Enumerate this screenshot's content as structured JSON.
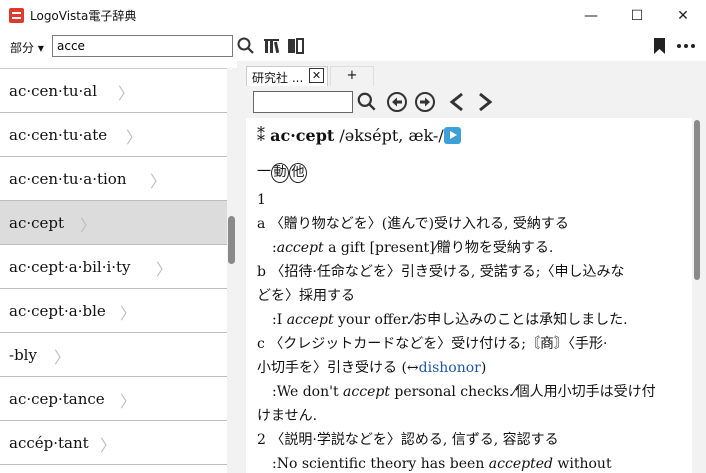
{
  "window": {
    "title": "LogoVista電子辞典",
    "minimize": "—",
    "maximize": "☐",
    "close": "✕"
  },
  "toolbar": {
    "category_label": "部分 ▾",
    "search_value": "acce"
  },
  "word_list": [
    {
      "word": "ac·cen·tu·al",
      "selected": false
    },
    {
      "word": "ac·cen·tu·ate",
      "selected": false
    },
    {
      "word": "ac·cen·tu·a·tion",
      "selected": false
    },
    {
      "word": "ac·cept",
      "selected": true
    },
    {
      "word": "ac·cept·a·bil·i·ty",
      "selected": false
    },
    {
      "word": "ac·cept·a·ble",
      "selected": false
    },
    {
      "word": "-bly",
      "selected": false
    },
    {
      "word": "ac·cep·tance",
      "selected": false
    },
    {
      "word": "accép·tant",
      "selected": false
    }
  ],
  "tabs": {
    "active_label": "研究社 ...",
    "close_glyph": "✕",
    "add_glyph": "+"
  },
  "entry": {
    "headword_mark": "⁑",
    "headword": "ac·cept",
    "pronunciation": "/əksépt, æk-/",
    "pos_dash": "一",
    "pos1": "動",
    "pos2": "他",
    "lines": [
      {
        "kind": "num",
        "text": "1"
      },
      {
        "kind": "sense",
        "label": "a",
        "text": "〈贈り物などを〉(進んで)受け入れる, 受納する"
      },
      {
        "kind": "ex",
        "pre": ":",
        "italic": "accept",
        "post": " a gift [present]⁄贈り物を受納する."
      },
      {
        "kind": "sense",
        "label": "b",
        "text": "〈招待·任命などを〉引き受ける, 受諾する;〈申し込みな"
      },
      {
        "kind": "cont",
        "text": "どを〉採用する"
      },
      {
        "kind": "ex",
        "pre": ":I ",
        "italic": "accept",
        "post": " your offer.⁄お申し込みのことは承知しました."
      },
      {
        "kind": "sense",
        "label": "c",
        "text": "〈クレジットカードなどを〉受け付ける;〘商〙〈手形·"
      },
      {
        "kind": "cont_link",
        "text": "小切手を〉引き受ける (↔",
        "link": "dishonor",
        "after": ")"
      },
      {
        "kind": "ex",
        "pre": ":We don't ",
        "italic": "accept",
        "post": " personal checks.⁄個人用小切手は受け付"
      },
      {
        "kind": "cont",
        "text": "けません."
      },
      {
        "kind": "sense",
        "label": "2",
        "text": "〈説明·学説などを〉認める, 信ずる, 容認する"
      },
      {
        "kind": "ex",
        "pre": ":No scientific theory has been ",
        "italic": "accepted",
        "post": " without"
      }
    ]
  }
}
